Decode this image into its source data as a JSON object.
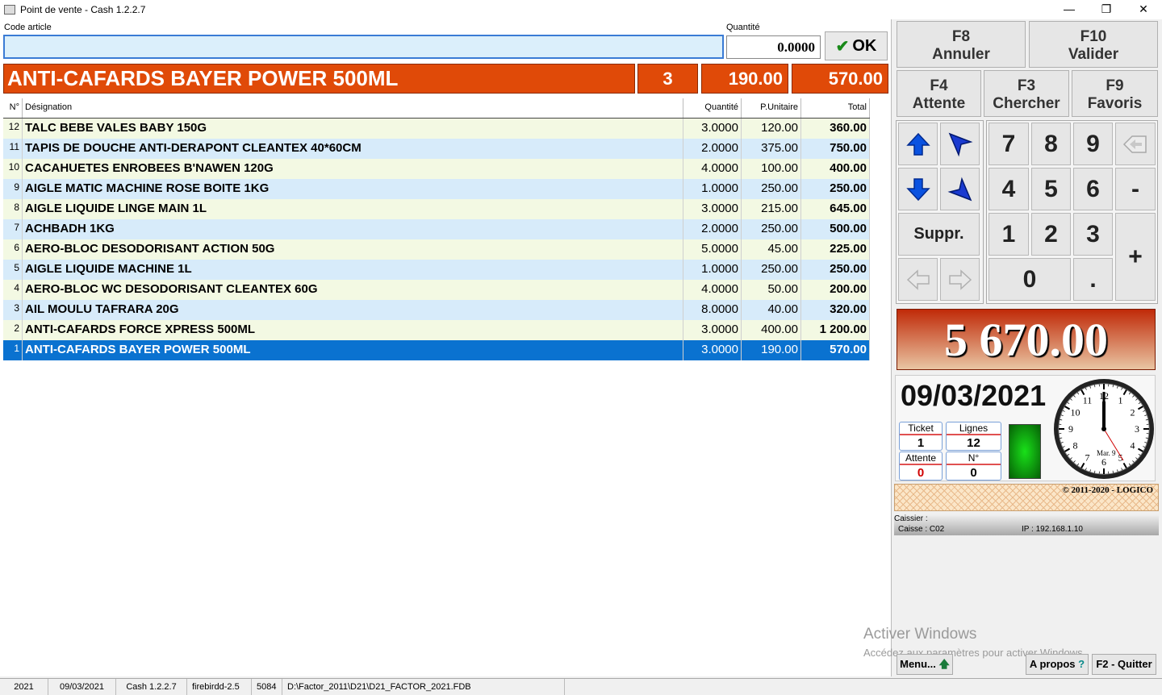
{
  "window": {
    "title": "Point de vente - Cash 1.2.2.7",
    "minimize": "—",
    "restore": "❐",
    "close": "✕"
  },
  "entry": {
    "code_label": "Code article",
    "code_value": "",
    "qty_label": "Quantité",
    "qty_value": "0.0000",
    "ok_label": "OK"
  },
  "current_item": {
    "name": "ANTI-CAFARDS BAYER POWER 500ML",
    "qty": "3",
    "unit_price": "190.00",
    "total": "570.00"
  },
  "grid": {
    "headers": {
      "n": "N°",
      "designation": "Désignation",
      "qty": "Quantité",
      "unit_price": "P.Unitaire",
      "total": "Total"
    },
    "rows": [
      {
        "n": "12",
        "designation": "TALC BEBE VALES BABY 150G",
        "qty": "3.0000",
        "unit_price": "120.00",
        "total": "360.00"
      },
      {
        "n": "11",
        "designation": "TAPIS DE DOUCHE ANTI-DERAPONT CLEANTEX 40*60CM",
        "qty": "2.0000",
        "unit_price": "375.00",
        "total": "750.00"
      },
      {
        "n": "10",
        "designation": "CACAHUETES ENROBEES B'NAWEN 120G",
        "qty": "4.0000",
        "unit_price": "100.00",
        "total": "400.00"
      },
      {
        "n": "9",
        "designation": "AIGLE MATIC MACHINE ROSE BOITE 1KG",
        "qty": "1.0000",
        "unit_price": "250.00",
        "total": "250.00"
      },
      {
        "n": "8",
        "designation": "AIGLE LIQUIDE LINGE MAIN 1L",
        "qty": "3.0000",
        "unit_price": "215.00",
        "total": "645.00"
      },
      {
        "n": "7",
        "designation": "ACHBADH 1KG",
        "qty": "2.0000",
        "unit_price": "250.00",
        "total": "500.00"
      },
      {
        "n": "6",
        "designation": "AERO-BLOC DESODORISANT ACTION 50G",
        "qty": "5.0000",
        "unit_price": "45.00",
        "total": "225.00"
      },
      {
        "n": "5",
        "designation": "AIGLE LIQUIDE MACHINE 1L",
        "qty": "1.0000",
        "unit_price": "250.00",
        "total": "250.00"
      },
      {
        "n": "4",
        "designation": "AERO-BLOC WC DESODORISANT CLEANTEX 60G",
        "qty": "4.0000",
        "unit_price": "50.00",
        "total": "200.00"
      },
      {
        "n": "3",
        "designation": "AIL MOULU TAFRARA 20G",
        "qty": "8.0000",
        "unit_price": "40.00",
        "total": "320.00"
      },
      {
        "n": "2",
        "designation": "ANTI-CAFARDS FORCE XPRESS 500ML",
        "qty": "3.0000",
        "unit_price": "400.00",
        "total": "1 200.00"
      },
      {
        "n": "1",
        "designation": "ANTI-CAFARDS BAYER POWER 500ML",
        "qty": "3.0000",
        "unit_price": "190.00",
        "total": "570.00"
      }
    ]
  },
  "fkeys": {
    "f8": {
      "key": "F8",
      "label": "Annuler"
    },
    "f10": {
      "key": "F10",
      "label": "Valider"
    },
    "f4": {
      "key": "F4",
      "label": "Attente"
    },
    "f3": {
      "key": "F3",
      "label": "Chercher"
    },
    "f9": {
      "key": "F9",
      "label": "Favoris"
    }
  },
  "numpad": {
    "digits": [
      "7",
      "8",
      "9",
      "4",
      "5",
      "6",
      "1",
      "2",
      "3",
      "0",
      "."
    ],
    "minus": "-",
    "plus": "+",
    "delete": "Suppr.",
    "icons": {
      "up": "arrow-up",
      "down": "arrow-down",
      "prev": "arrow-left",
      "next": "arrow-right",
      "backspace": "backspace"
    }
  },
  "total": "5 670.00",
  "info": {
    "date": "09/03/2021",
    "ticket": {
      "label": "Ticket",
      "value": "1"
    },
    "lines": {
      "label": "Lignes",
      "value": "12"
    },
    "waiting": {
      "label": "Attente",
      "value": "0"
    },
    "number": {
      "label": "N°",
      "value": "0"
    },
    "clock_date": "Mar. 9",
    "clock_numbers": [
      "12",
      "1",
      "2",
      "3",
      "4",
      "5",
      "6",
      "7",
      "8",
      "9",
      "10",
      "11"
    ]
  },
  "copyright": "© 2011-2020 - LOGICO",
  "cashier": {
    "label": "Caissier :",
    "caisse": "Caisse : C02",
    "ip": "IP : 192.168.1.10"
  },
  "watermark": {
    "line1": "Activer Windows",
    "line2": "Accédez aux paramètres pour activer Windows."
  },
  "bottom_buttons": {
    "menu": "Menu...",
    "about": "A propos",
    "quit": "F2 - Quitter"
  },
  "statusbar": [
    "2021",
    "09/03/2021",
    "Cash 1.2.2.7",
    "firebirdd-2.5",
    "5084",
    "D:\\Factor_2011\\D21\\D21_FACTOR_2021.FDB"
  ],
  "colors": {
    "banner": "#e04a08",
    "selected_row": "#0a72d0",
    "even_row": "#f3f9e3",
    "odd_row": "#d7ebfa",
    "total_text": "#ffffff"
  }
}
